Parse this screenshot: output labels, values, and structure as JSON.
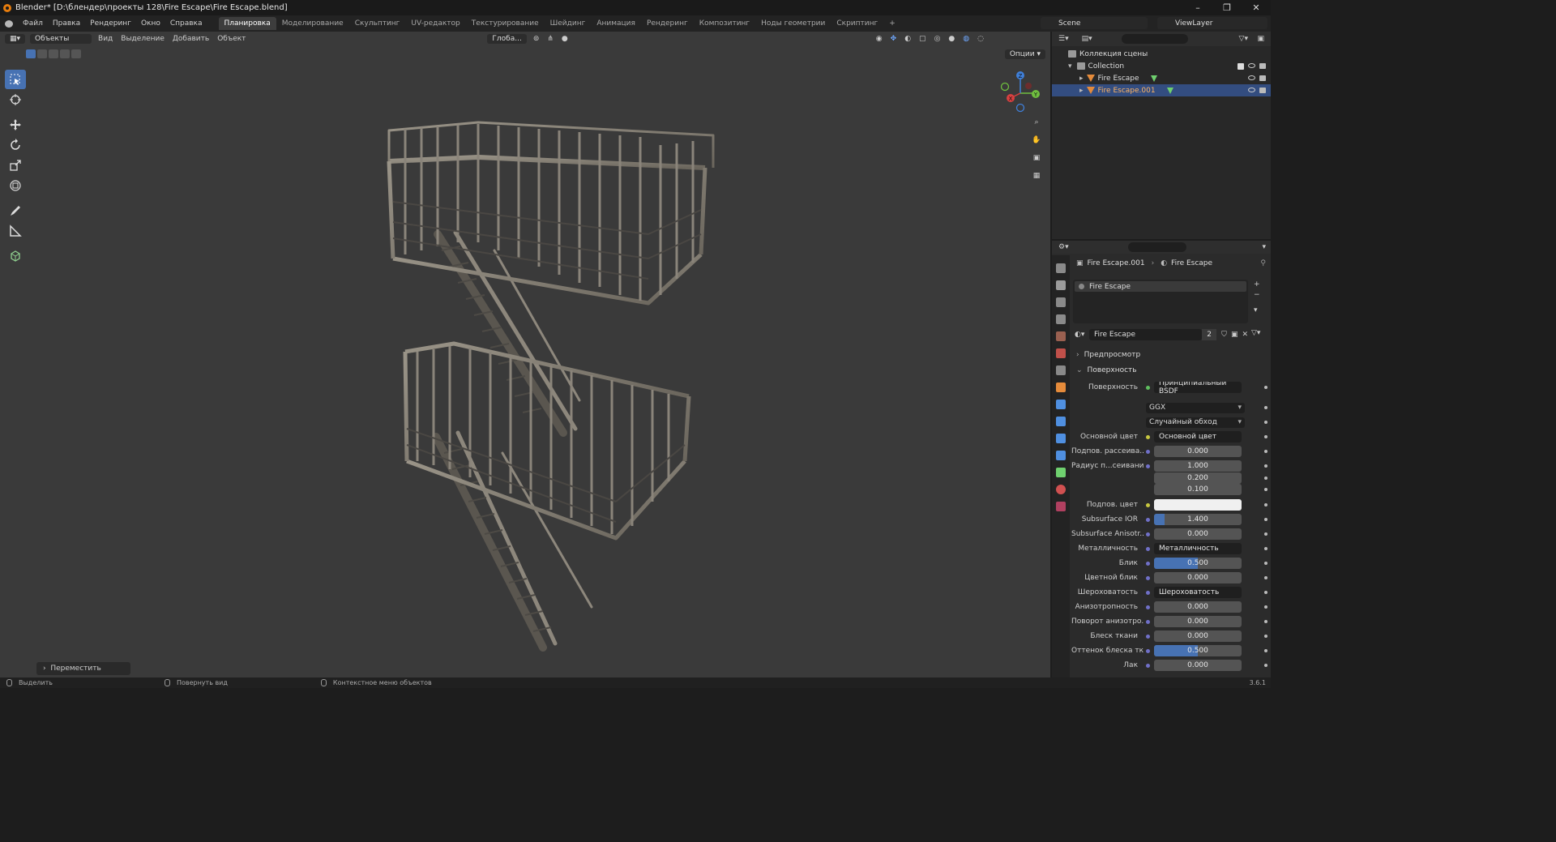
{
  "window": {
    "title": "Blender* [D:\\блендер\\проекты 128\\Fire Escape\\Fire Escape.blend]",
    "controls": [
      "–",
      "❐",
      "✕"
    ]
  },
  "menus": [
    "Файл",
    "Правка",
    "Рендеринг",
    "Окно",
    "Справка"
  ],
  "workspaces": {
    "tabs": [
      "Планировка",
      "Моделирование",
      "Скульптинг",
      "UV-редактор",
      "Текстурирование",
      "Шейдинг",
      "Анимация",
      "Рендеринг",
      "Композитинг",
      "Ноды геометрии",
      "Скриптинг"
    ],
    "active": "Планировка",
    "add": "+"
  },
  "scene": {
    "name": "Scene",
    "view_layer": "ViewLayer"
  },
  "viewport": {
    "mode": "Объекты",
    "menus": [
      "Вид",
      "Выделение",
      "Добавить",
      "Объект"
    ],
    "transform_orientation": "Глоба...",
    "options": "Опции",
    "operator_panel": "Переместить",
    "gizmo": {
      "x": "X",
      "y": "Y",
      "z": "Z"
    }
  },
  "outliner": {
    "scene_collection": "Коллекция сцены",
    "collection": "Collection",
    "objects": [
      {
        "name": "Fire Escape",
        "selected": false
      },
      {
        "name": "Fire Escape.001",
        "selected": true
      }
    ]
  },
  "properties": {
    "breadcrumb": {
      "object": "Fire Escape.001",
      "material": "Fire Escape"
    },
    "slot": "Fire Escape",
    "material_name": "Fire Escape",
    "users": "2",
    "sections": {
      "preview": "Предпросмотр",
      "surface": "Поверхность"
    },
    "rows": [
      {
        "label": "Поверхность",
        "value": "Принципиальный BSDF",
        "kind": "link",
        "dot": "g"
      },
      {
        "label": "",
        "value": "GGX",
        "kind": "select"
      },
      {
        "label": "",
        "value": "Случайный обход",
        "kind": "select"
      },
      {
        "label": "Основной цвет",
        "value": "Основной цвет",
        "kind": "link",
        "dot": "y",
        "expand": true
      },
      {
        "label": "Подпов. рассеива...",
        "value": "0.000",
        "kind": "num",
        "dot": "b",
        "fill": 0
      },
      {
        "label": "Радиус п...сеивания",
        "value": "1.000",
        "kind": "num",
        "dot": "b",
        "fill": 0
      },
      {
        "label": "",
        "value": "0.200",
        "kind": "num",
        "fill": 0
      },
      {
        "label": "",
        "value": "0.100",
        "kind": "num",
        "fill": 0
      },
      {
        "label": "Подпов. цвет",
        "value": "",
        "kind": "color",
        "dot": "y"
      },
      {
        "label": "Subsurface IOR",
        "value": "1.400",
        "kind": "num",
        "dot": "b",
        "fill": 0.12
      },
      {
        "label": "Subsurface Anisotr...",
        "value": "0.000",
        "kind": "num",
        "dot": "b",
        "fill": 0
      },
      {
        "label": "Металличность",
        "value": "Металличность",
        "kind": "link",
        "dot": "b",
        "expand": true
      },
      {
        "label": "Блик",
        "value": "0.500",
        "kind": "num",
        "dot": "b",
        "fill": 0.5
      },
      {
        "label": "Цветной блик",
        "value": "0.000",
        "kind": "num",
        "dot": "b",
        "fill": 0
      },
      {
        "label": "Шероховатость",
        "value": "Шероховатость",
        "kind": "link",
        "dot": "b",
        "expand": true
      },
      {
        "label": "Анизотропность",
        "value": "0.000",
        "kind": "num",
        "dot": "b",
        "fill": 0
      },
      {
        "label": "Поворот анизотро...",
        "value": "0.000",
        "kind": "num",
        "dot": "b",
        "fill": 0
      },
      {
        "label": "Блеск ткани",
        "value": "0.000",
        "kind": "num",
        "dot": "b",
        "fill": 0
      },
      {
        "label": "Оттенок блеска тк...",
        "value": "0.500",
        "kind": "num",
        "dot": "b",
        "fill": 0.5
      },
      {
        "label": "Лак",
        "value": "0.000",
        "kind": "num",
        "dot": "b",
        "fill": 0
      }
    ]
  },
  "status": {
    "left": "Выделить",
    "middle": "Повернуть вид",
    "right": "Контекстное меню объектов",
    "version": "3.6.1"
  },
  "colors": {
    "accent": "#4772b3",
    "selected_row": "#334d80",
    "mesh_icon": "#e58b3b"
  }
}
